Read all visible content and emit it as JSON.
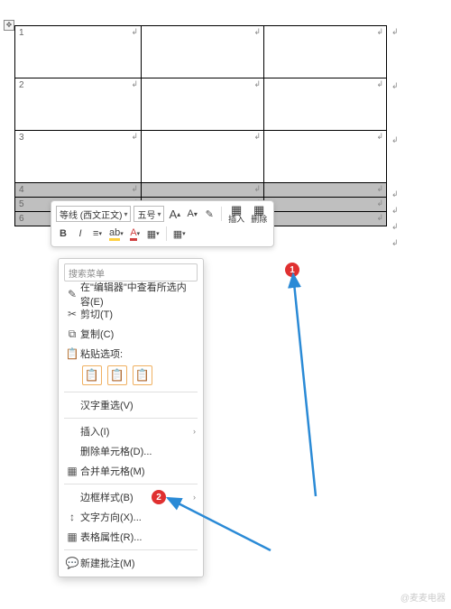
{
  "table": {
    "rows": [
      {
        "cells": [
          "1",
          "",
          ""
        ],
        "height": "big"
      },
      {
        "cells": [
          "2",
          "",
          ""
        ],
        "height": "big"
      },
      {
        "cells": [
          "3",
          "",
          ""
        ],
        "height": "big"
      },
      {
        "cells": [
          "4",
          "",
          ""
        ],
        "height": "small",
        "selected": true
      },
      {
        "cells": [
          "5",
          "",
          ""
        ],
        "height": "small",
        "selected": true
      },
      {
        "cells": [
          "6",
          "",
          ""
        ],
        "height": "small",
        "selected": true
      }
    ]
  },
  "mini_toolbar": {
    "font_name": "等线 (西文正文)",
    "font_size": "五号",
    "inc_font": "A",
    "dec_font": "A",
    "brush": "🖌",
    "insert_label": "插入",
    "delete_label": "删除"
  },
  "context_menu": {
    "search_placeholder": "搜索菜单",
    "items": {
      "view_in_editor": "在\"编辑器\"中查看所选内容(E)",
      "cut": "剪切(T)",
      "copy": "复制(C)",
      "paste_options": "粘贴选项:",
      "cn_reselect": "汉字重选(V)",
      "insert": "插入(I)",
      "delete_cells": "删除单元格(D)...",
      "merge_cells": "合并单元格(M)",
      "border_style": "边框样式(B)",
      "text_direction": "文字方向(X)...",
      "table_properties": "表格属性(R)...",
      "new_comment": "新建批注(M)"
    }
  },
  "annotations": {
    "badge1": "1",
    "badge2": "2"
  },
  "watermark": "@麦麦电器"
}
